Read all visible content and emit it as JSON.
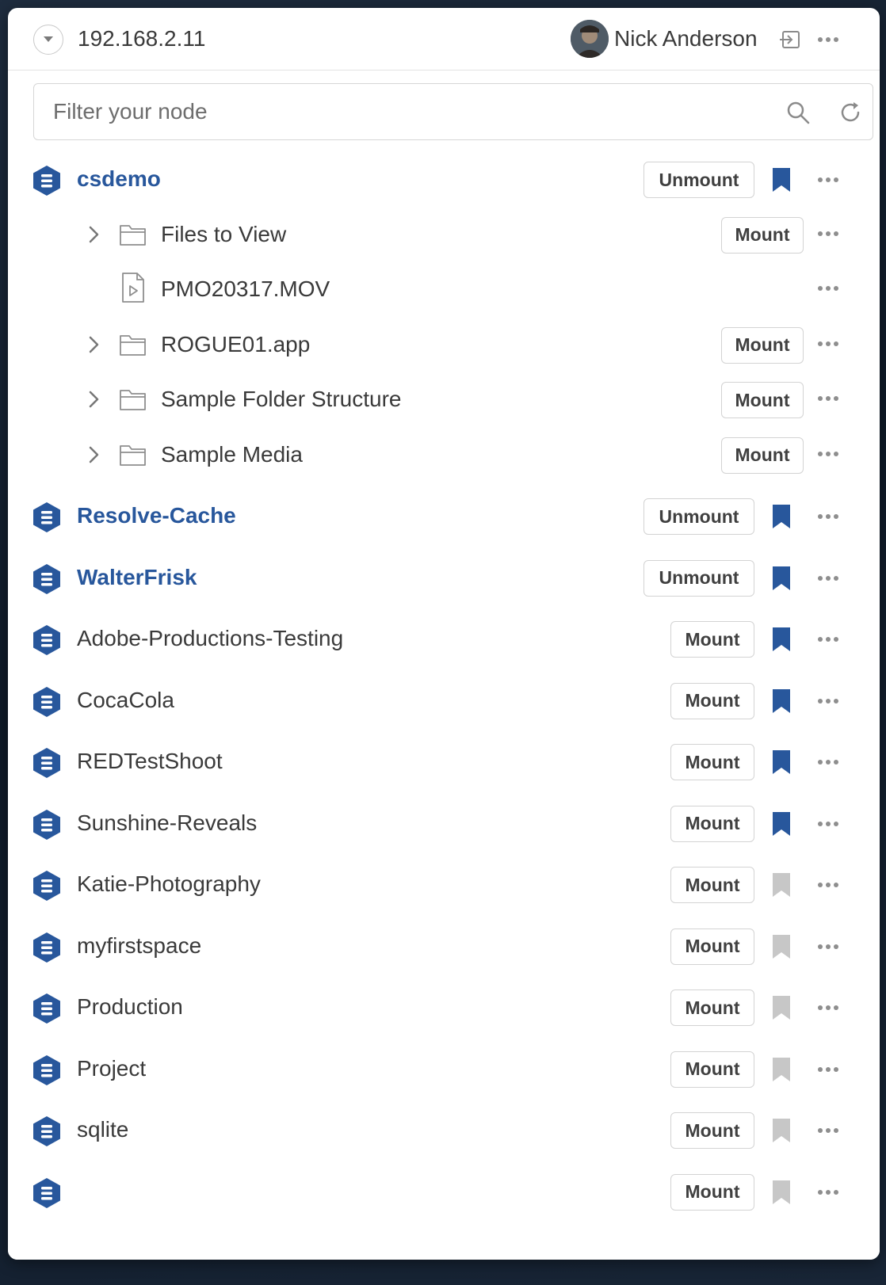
{
  "header": {
    "host": "192.168.2.11",
    "user_name": "Nick Anderson"
  },
  "search": {
    "placeholder": "Filter your node"
  },
  "colors": {
    "accent": "#28579c",
    "bookmark_active": "#28579c",
    "bookmark_inactive": "#c7c7c7"
  },
  "spaces": [
    {
      "name": "csdemo",
      "mounted": true,
      "button": "Unmount",
      "bookmarked": true,
      "children": [
        {
          "name": "Files to View",
          "kind": "folder",
          "button": "Mount"
        },
        {
          "name": "PMO20317.MOV",
          "kind": "file",
          "button": ""
        },
        {
          "name": "ROGUE01.app",
          "kind": "folder",
          "button": "Mount"
        },
        {
          "name": "Sample Folder Structure",
          "kind": "folder",
          "button": "Mount"
        },
        {
          "name": "Sample Media",
          "kind": "folder",
          "button": "Mount"
        }
      ]
    },
    {
      "name": "Resolve-Cache",
      "mounted": true,
      "button": "Unmount",
      "bookmarked": true
    },
    {
      "name": "WalterFrisk",
      "mounted": true,
      "button": "Unmount",
      "bookmarked": true
    },
    {
      "name": "Adobe-Productions-Testing",
      "mounted": false,
      "button": "Mount",
      "bookmarked": true
    },
    {
      "name": "CocaCola",
      "mounted": false,
      "button": "Mount",
      "bookmarked": true
    },
    {
      "name": "REDTestShoot",
      "mounted": false,
      "button": "Mount",
      "bookmarked": true
    },
    {
      "name": "Sunshine-Reveals",
      "mounted": false,
      "button": "Mount",
      "bookmarked": true
    },
    {
      "name": "Katie-Photography",
      "mounted": false,
      "button": "Mount",
      "bookmarked": false
    },
    {
      "name": "myfirstspace",
      "mounted": false,
      "button": "Mount",
      "bookmarked": false
    },
    {
      "name": "Production",
      "mounted": false,
      "button": "Mount",
      "bookmarked": false
    },
    {
      "name": "Project",
      "mounted": false,
      "button": "Mount",
      "bookmarked": false
    },
    {
      "name": "sqlite",
      "mounted": false,
      "button": "Mount",
      "bookmarked": false
    },
    {
      "name": "",
      "mounted": false,
      "button": "Mount",
      "bookmarked": false
    }
  ]
}
